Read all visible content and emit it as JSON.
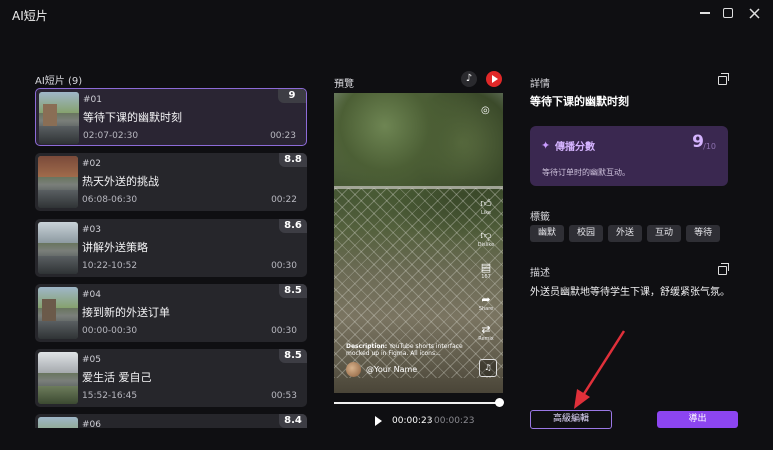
{
  "window": {
    "title": "AI短片"
  },
  "list": {
    "header": "AI短片 (9)",
    "items": [
      {
        "num": "#01",
        "title": "等待下课的幽默时刻",
        "range": "02:07-02:30",
        "duration": "00:23",
        "score": "9",
        "active": true
      },
      {
        "num": "#02",
        "title": "热天外送的挑战",
        "range": "06:08-06:30",
        "duration": "00:22",
        "score": "8.8"
      },
      {
        "num": "#03",
        "title": "讲解外送策略",
        "range": "10:22-10:52",
        "duration": "00:30",
        "score": "8.6"
      },
      {
        "num": "#04",
        "title": "接到新的外送订单",
        "range": "00:00-00:30",
        "duration": "00:30",
        "score": "8.5"
      },
      {
        "num": "#05",
        "title": "爱生活 爱自己",
        "range": "15:52-16:45",
        "duration": "00:53",
        "score": "8.5"
      },
      {
        "num": "#06",
        "title": "",
        "range": "",
        "duration": "",
        "score": "8.4"
      }
    ]
  },
  "preview": {
    "header": "預覽",
    "platform_icons": [
      "tiktok-icon",
      "youtube-icon"
    ],
    "overlay": {
      "like": "Like",
      "dislike": "Dislike",
      "comment_count": "167",
      "share": "Share",
      "remix": "Remix",
      "desc_bold": "Description:",
      "desc_rest": " YouTube shorts interface mocked up in Figma. All icons...",
      "channel": "@Your Name"
    },
    "progress": 1.0,
    "time_current": "00:00:23",
    "time_sep": "/",
    "time_total": "00:00:23"
  },
  "details": {
    "header": "詳情",
    "clip_title": "等待下课的幽默时刻",
    "score_label": "傳播分數",
    "score_value": "9",
    "score_denominator": "/10",
    "score_desc": "等待订单时的幽默互动。",
    "tags_header": "標籤",
    "tags": [
      "幽默",
      "校园",
      "外送",
      "互动",
      "等待"
    ],
    "desc_header": "描述",
    "desc_text": "外送员幽默地等待学生下课，舒缓紧张气氛。"
  },
  "actions": {
    "advanced_label": "高級編輯",
    "export_label": "導出"
  },
  "colors": {
    "accent": "#8c45f0",
    "accent_border": "#9b78e6",
    "score_bg": "#3a2850",
    "arrow": "#e0303a"
  }
}
